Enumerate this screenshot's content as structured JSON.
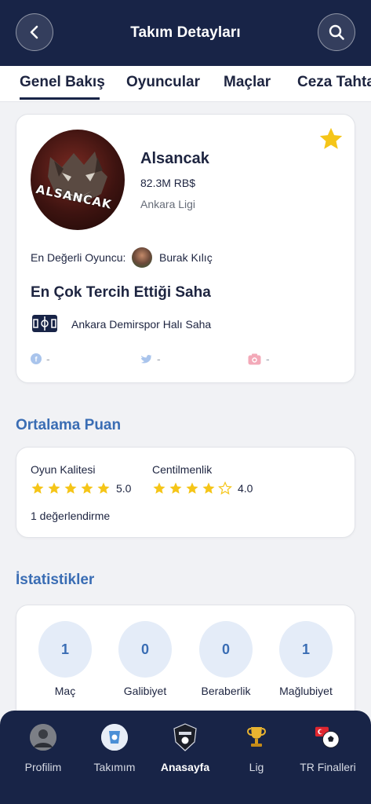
{
  "header": {
    "title": "Takım Detayları",
    "back_icon": "chevron-left-icon",
    "search_icon": "search-icon"
  },
  "tabs": [
    {
      "label": "Genel Bakış",
      "active": true
    },
    {
      "label": "Oyuncular"
    },
    {
      "label": "Maçlar"
    },
    {
      "label": "Ceza Tahtası"
    }
  ],
  "team": {
    "logo_text": "ALSANCAK",
    "name": "Alsancak",
    "value": "82.3M RB$",
    "league": "Ankara Ligi",
    "favorite_icon": "star-icon",
    "mvp_label": "En Değerli Oyuncu:",
    "mvp_name": "Burak Kılıç",
    "pitch_title": "En Çok Tercih Ettiği Saha",
    "pitch_name": "Ankara Demirspor Halı Saha",
    "socials": [
      {
        "icon": "facebook-icon",
        "value": "-"
      },
      {
        "icon": "twitter-icon",
        "value": "-"
      },
      {
        "icon": "instagram-icon",
        "value": "-"
      }
    ]
  },
  "rating": {
    "section_title": "Ortalama Puan",
    "items": [
      {
        "label": "Oyun Kalitesi",
        "score": "5.0",
        "stars": 5
      },
      {
        "label": "Centilmenlik",
        "score": "4.0",
        "stars": 4
      }
    ],
    "count_text": "1 değerlendirme"
  },
  "stats": {
    "section_title": "İstatistikler",
    "items": [
      {
        "label": "Maç",
        "value": "1"
      },
      {
        "label": "Galibiyet",
        "value": "0"
      },
      {
        "label": "Beraberlik",
        "value": "0"
      },
      {
        "label": "Mağlubiyet",
        "value": "1"
      }
    ]
  },
  "bottom_nav": [
    {
      "label": "Profilim",
      "icon": "profile-avatar-icon"
    },
    {
      "label": "Takımım",
      "icon": "team-logo-icon"
    },
    {
      "label": "Anasayfa",
      "icon": "league-badge-icon",
      "active": true
    },
    {
      "label": "Lig",
      "icon": "trophy-icon"
    },
    {
      "label": "TR Finalleri",
      "icon": "turkey-ball-icon"
    }
  ],
  "colors": {
    "header_bg": "#182447",
    "accent_blue": "#3a6db4",
    "star_gold": "#f5c518",
    "stat_circle_bg": "#e4ecf8"
  }
}
